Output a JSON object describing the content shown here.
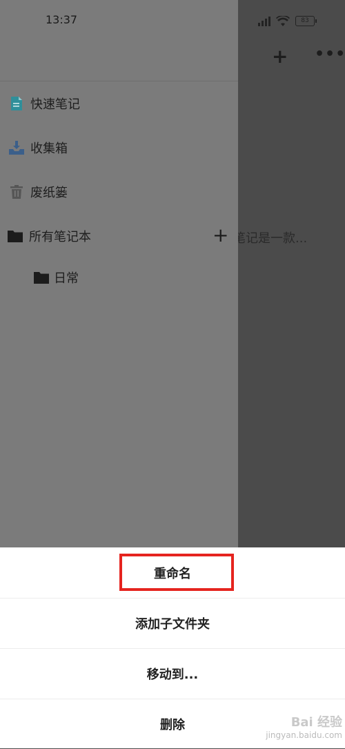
{
  "status_bar": {
    "time": "13:37",
    "battery": "83"
  },
  "background": {
    "note_preview": "笔记是一款..."
  },
  "drawer": {
    "items": [
      {
        "label": "快速笔记",
        "icon": "document-icon"
      },
      {
        "label": "收集箱",
        "icon": "inbox-download-icon"
      },
      {
        "label": "废纸篓",
        "icon": "trash-icon"
      },
      {
        "label": "所有笔记本",
        "icon": "folder-icon"
      },
      {
        "label": "日常",
        "icon": "folder-icon"
      }
    ]
  },
  "sheet": {
    "actions": [
      "重命名",
      "添加子文件夹",
      "移动到...",
      "删除"
    ]
  },
  "watermark": {
    "brand": "Bai 经验",
    "url": "jingyan.baidu.com"
  },
  "colors": {
    "highlight": "#e5241f",
    "doc_icon": "#2f8f9a",
    "inbox_icon": "#3b5f8a"
  }
}
